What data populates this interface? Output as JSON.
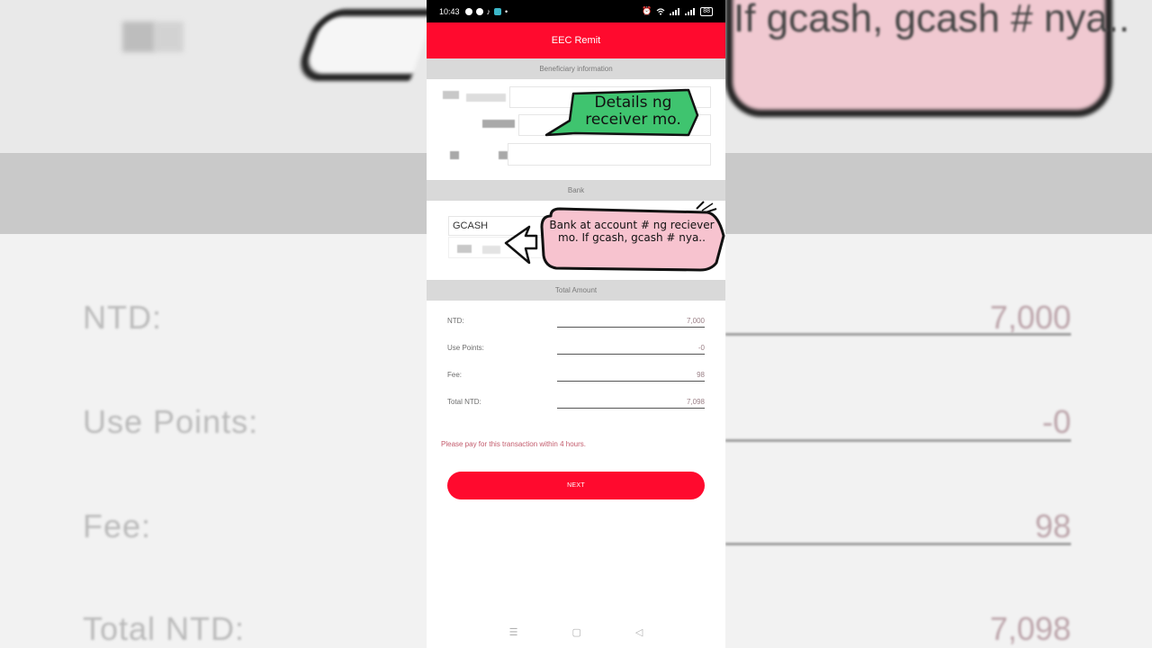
{
  "background": {
    "labels": [
      "NTD:",
      "Use Points:",
      "Fee:",
      "Total NTD:"
    ],
    "values": [
      "7,000",
      "-0",
      "98",
      "7,098"
    ],
    "bubble_text": "If gcash, gcash # nya.."
  },
  "status_bar": {
    "time": "10:43",
    "battery": "88"
  },
  "app": {
    "title": "EEC Remit"
  },
  "sections": {
    "beneficiary": "Beneficiary information",
    "bank": "Bank",
    "total": "Total Amount"
  },
  "bank": {
    "value": "GCASH"
  },
  "amounts": [
    {
      "label": "NTD:",
      "value": "7,000"
    },
    {
      "label": "Use Points:",
      "value": "-0"
    },
    {
      "label": "Fee:",
      "value": "98"
    },
    {
      "label": "Total NTD:",
      "value": "7,098"
    }
  ],
  "notice": "Please pay for this transaction within 4 hours.",
  "next_label": "NEXT",
  "annotations": {
    "green": "Details ng receiver mo.",
    "pink": "Bank at account # ng reciever mo. If gcash, gcash # nya.."
  },
  "colors": {
    "accent": "#ff0a2e",
    "sticker_green": "#3fc46f",
    "sticker_pink": "#f7c3cf"
  }
}
